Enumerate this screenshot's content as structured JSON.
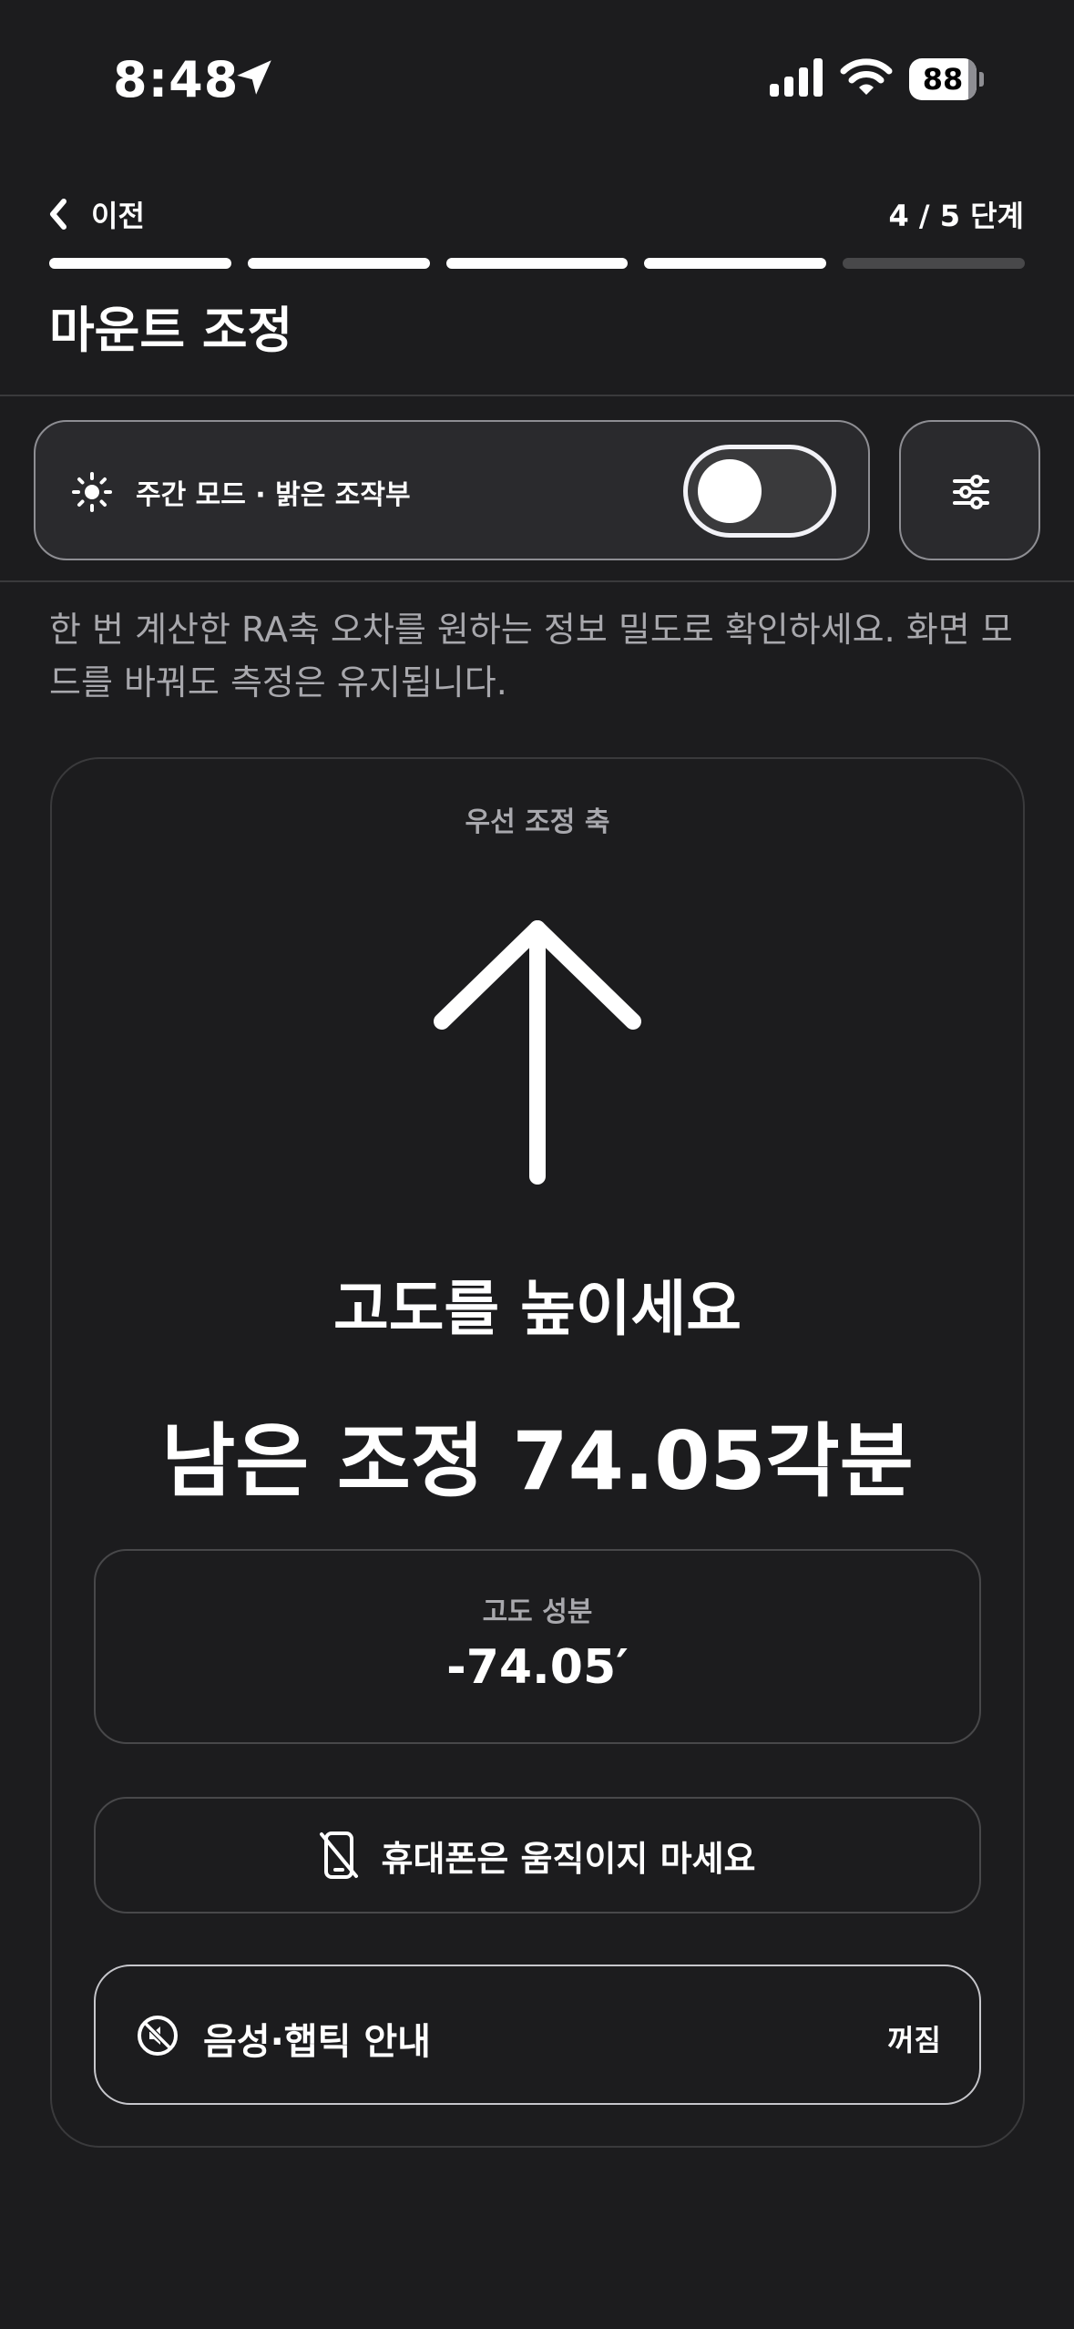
{
  "status_bar": {
    "time": "8:48",
    "battery": "88"
  },
  "nav": {
    "back_label": "이전",
    "step": "4 / 5 단계",
    "progress_total": 5,
    "progress_current": 4
  },
  "page": {
    "title": "마운트 조정"
  },
  "mode": {
    "label": "주간 모드 · 밝은 조작부",
    "enabled": true
  },
  "description": "한 번 계산한 RA축 오차를 원하는 정보 밀도로 확인하세요. 화면 모드를 바꿔도 측정은 유지됩니다.",
  "card": {
    "axis_label": "우선 조정 축",
    "instruction": "고도를 높이세요",
    "remaining": "남은 조정 74.05각분",
    "component_label": "고도 성분",
    "component_value": "-74.05′",
    "hold_still": "휴대폰은 움직이지 마세요",
    "voice_label": "음성·햅틱 안내",
    "voice_status": "꺼짐"
  },
  "icons": {
    "location": "location-arrow-icon",
    "signal": "cellular-signal-icon",
    "wifi": "wifi-icon",
    "back": "chevron-left-icon",
    "sun": "sun-icon",
    "sliders": "sliders-icon",
    "arrow": "arrow-up-icon",
    "phone": "phone-no-move-icon",
    "mute": "mute-icon"
  },
  "colors": {
    "background": "#1c1c1e",
    "text": "#ffffff",
    "secondary": "#a8a8ad",
    "border": "#48484a"
  }
}
